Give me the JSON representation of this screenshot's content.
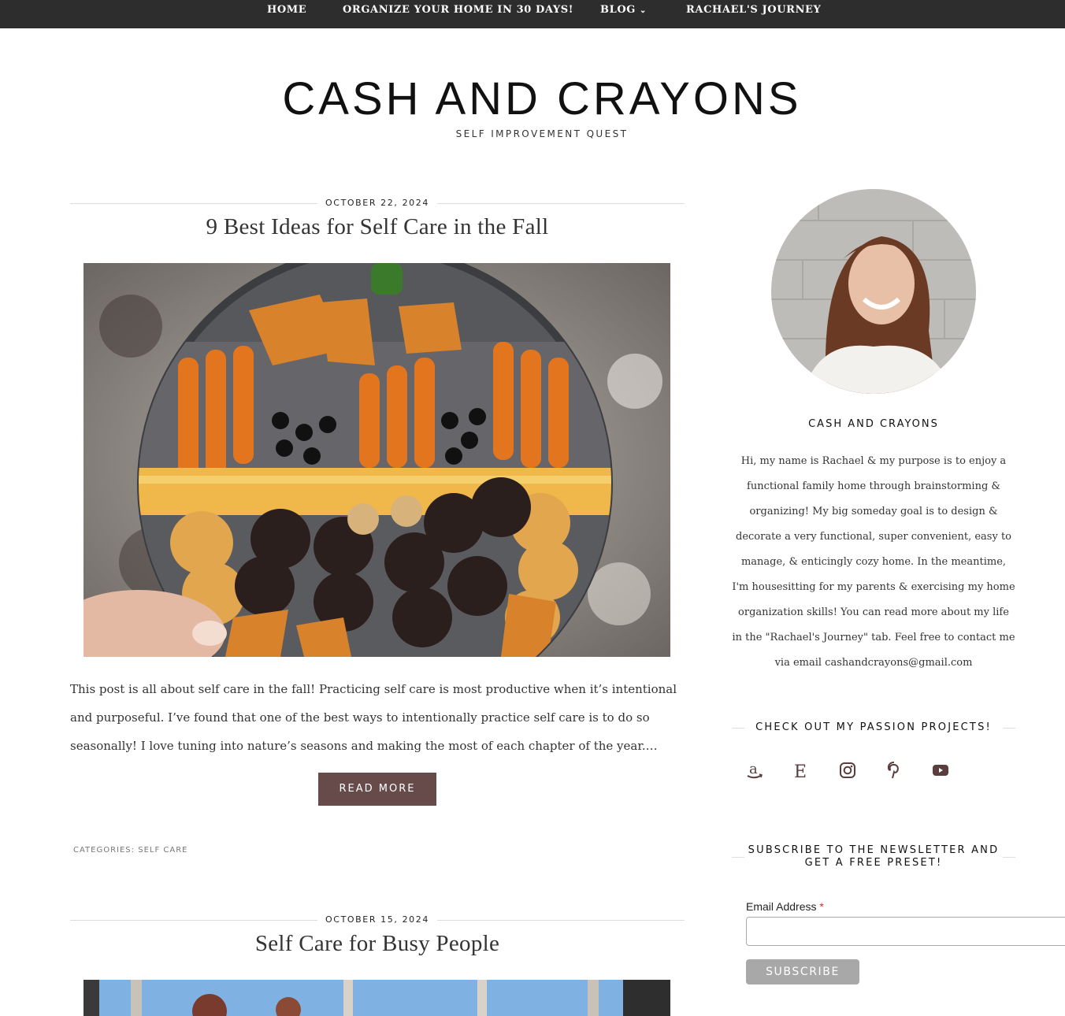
{
  "nav": {
    "items": [
      {
        "label": "HOME"
      },
      {
        "label": "ORGANIZE YOUR HOME IN 30 DAYS!"
      },
      {
        "label": "BLOG",
        "icon": "chevron-down-icon"
      },
      {
        "label": "RACHAEL'S JOURNEY"
      }
    ]
  },
  "header": {
    "title": "CASH AND CRAYONS",
    "tagline": "SELF IMPROVEMENT QUEST"
  },
  "posts": [
    {
      "date": "OCTOBER 22, 2024",
      "title": "9 Best Ideas for Self Care in the Fall",
      "excerpt": "This post is all about self care in the fall! Practicing self care is most productive when it’s intentional and purposeful. I’ve found that one of the best ways to intentionally practice self care is to do so seasonally! I love tuning into nature’s seasons and making the most of each chapter of the year.…",
      "read_more": "READ MORE",
      "categories_label": "CATEGORIES:",
      "category": "SELF CARE"
    },
    {
      "date": "OCTOBER 15, 2024",
      "title": "Self Care for Busy People"
    }
  ],
  "sidebar": {
    "name": "CASH AND CRAYONS",
    "bio": "Hi, my name is Rachael & my purpose is to enjoy a functional family home through brainstorming & organizing! My big someday goal is to design & decorate a very functional, super convenient, easy to manage, & enticingly cozy home. In the meantime, I'm housesitting for my parents & exercising my home organization skills! You can read more about my life in the \"Rachael's Journey\" tab. Feel free to contact me via email cashandcrayons@gmail.com",
    "projects_heading": "CHECK OUT MY PASSION PROJECTS!",
    "social": [
      "amazon-icon",
      "etsy-icon",
      "instagram-icon",
      "pinterest-icon",
      "youtube-icon"
    ],
    "newsletter_heading_line1": "SUBSCRIBE TO THE NEWSLETTER AND",
    "newsletter_heading_line2": "GET A FREE PRESET!",
    "email_label": "Email Address",
    "email_required": "*",
    "subscribe": "SUBSCRIBE"
  },
  "colors": {
    "nav_bg": "#2d2d2d",
    "accent": "#674b4b",
    "subscribe_bg": "#a8a8a8"
  }
}
